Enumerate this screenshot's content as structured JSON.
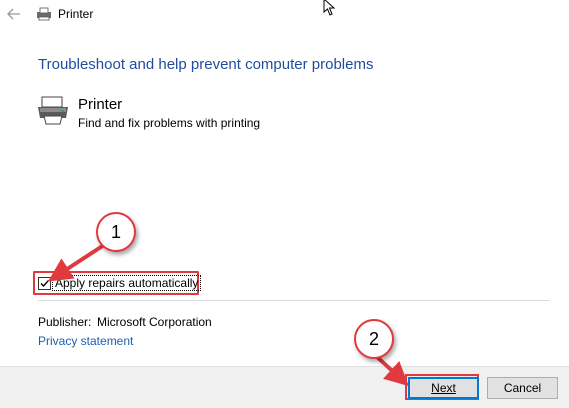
{
  "window": {
    "title": "Printer",
    "back_icon": "back-arrow-icon",
    "title_icon": "printer-icon"
  },
  "main": {
    "heading": "Troubleshoot and help prevent computer problems",
    "item": {
      "icon": "printer-icon",
      "title": "Printer",
      "description": "Find and fix problems with printing"
    },
    "apply_repairs": {
      "label": "Apply repairs automatically",
      "checked": true
    },
    "publisher_label": "Publisher:",
    "publisher_value": "Microsoft Corporation",
    "privacy_link": "Privacy statement"
  },
  "footer": {
    "next_label": "Next",
    "cancel_label": "Cancel"
  },
  "annotations": {
    "callout_1": "1",
    "callout_2": "2",
    "color": "#e0393e"
  },
  "colors": {
    "heading": "#1f4d9e",
    "link": "#1a5fb4",
    "footer_bg": "#f0f0f0",
    "focus_border": "#0078d7"
  }
}
